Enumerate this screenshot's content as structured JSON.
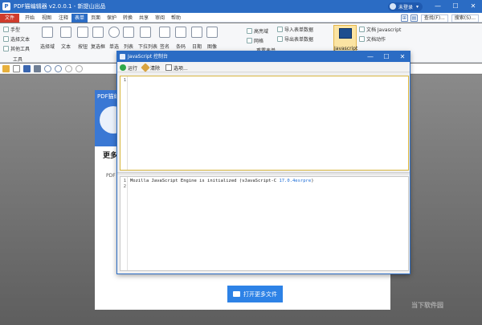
{
  "window": {
    "title": "PDF猫编辑器 v2.0.0.1 - 新提山出品",
    "user_status": "未登录",
    "controls": [
      "—",
      "☐",
      "✕"
    ]
  },
  "menu": {
    "tabs": [
      "文件",
      "开始",
      "视图",
      "注释",
      "表单",
      "页面",
      "保护",
      "转换",
      "共享",
      "审阅",
      "帮助"
    ],
    "active": "表单",
    "search_label": "查找(F)...",
    "advanced_search_label": "搜索(S)..."
  },
  "ribbon": {
    "tools_group": {
      "label": "工具",
      "items": [
        "手型",
        "选择文本",
        "其他工具"
      ]
    },
    "form_tools": [
      "选择域",
      "文本",
      "按钮",
      "复选框",
      "单选",
      "列表",
      "下拉列表",
      "签名",
      "条码",
      "日期",
      "图像"
    ],
    "right_small_items": [
      "高亮域",
      "网格",
      "导入表单数据",
      "导出表单数据",
      "重置表单"
    ],
    "javascript_label": "Javascript",
    "js_side_items": [
      "文档 Javascript",
      "文档动作"
    ]
  },
  "document": {
    "header_title": "PDF猫编",
    "more_text": "更多",
    "pdf_text": "PDF",
    "open_more_button": "打开更多文件"
  },
  "console": {
    "title": "JavaScript 控制台",
    "run_label": "运行",
    "clear_label": "清除",
    "options_label": "选项...",
    "top_editor": {
      "lines": [
        "1"
      ]
    },
    "bottom_editor": {
      "lines": [
        "1",
        "2"
      ],
      "output_prefix": "Mozilla JavaScript Engine is initialized (vJavaScript-C ",
      "output_version": "17.0.4esrpre",
      "output_suffix": ")"
    }
  },
  "watermark": "当下软件园",
  "colors": {
    "title_blue": "#2b6cc4",
    "file_tab_red": "#cf3b2c",
    "js_highlight": "#fbe4a3",
    "open_button_blue": "#2d82e6"
  }
}
